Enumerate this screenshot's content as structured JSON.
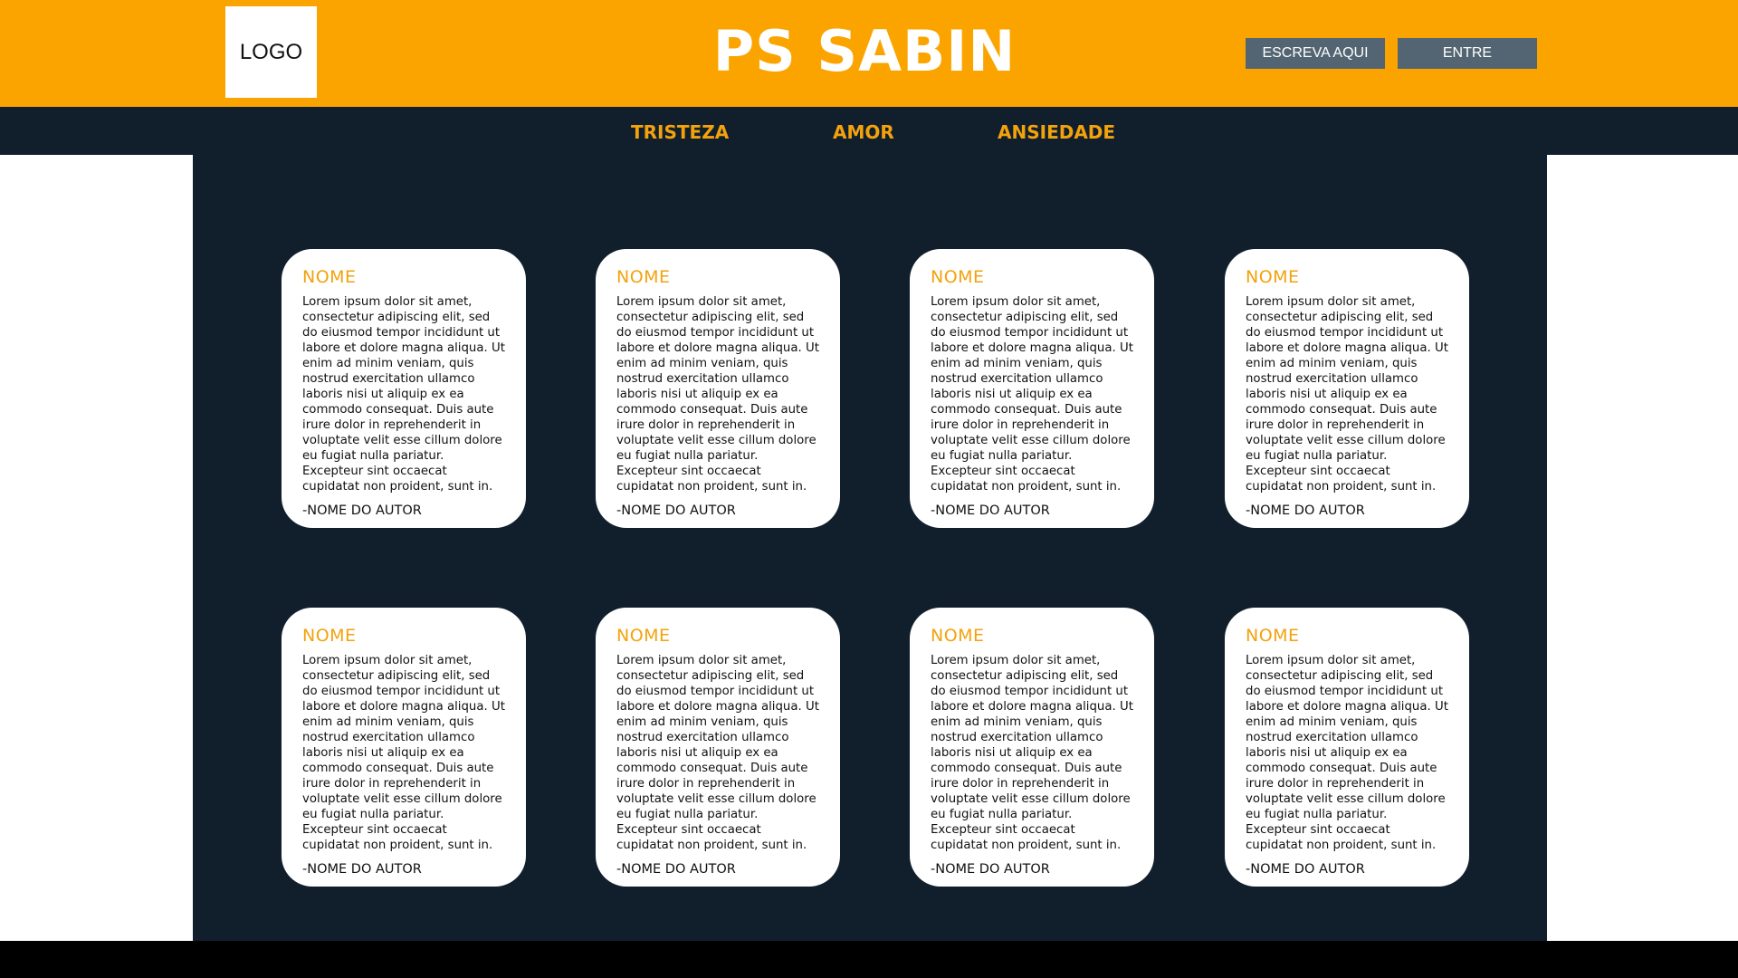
{
  "header": {
    "logo_label": "LOGO",
    "title": "PS SABIN",
    "write_button": "ESCREVA AQUI",
    "login_button": "ENTRE",
    "background_color": "#fba400"
  },
  "nav": {
    "items": [
      "TRISTEZA",
      "AMOR",
      "ANSIEDADE"
    ],
    "text_color": "#f3a20d",
    "background_color": "#111f2c"
  },
  "cards": [
    {
      "name": "NOME",
      "text": "Lorem ipsum dolor sit amet, consectetur adipiscing elit, sed do eiusmod tempor incididunt ut labore et dolore magna aliqua. Ut enim ad minim veniam, quis nostrud exercitation ullamco laboris nisi ut aliquip ex ea commodo consequat. Duis aute irure dolor in reprehenderit in voluptate velit esse cillum dolore eu fugiat nulla pariatur. Excepteur sint occaecat cupidatat non proident, sunt in.",
      "author": "-NOME DO AUTOR"
    },
    {
      "name": "NOME",
      "text": "Lorem ipsum dolor sit amet, consectetur adipiscing elit, sed do eiusmod tempor incididunt ut labore et dolore magna aliqua. Ut enim ad minim veniam, quis nostrud exercitation ullamco laboris nisi ut aliquip ex ea commodo consequat. Duis aute irure dolor in reprehenderit in voluptate velit esse cillum dolore eu fugiat nulla pariatur. Excepteur sint occaecat cupidatat non proident, sunt in.",
      "author": "-NOME DO AUTOR"
    },
    {
      "name": "NOME",
      "text": "Lorem ipsum dolor sit amet, consectetur adipiscing elit, sed do eiusmod tempor incididunt ut labore et dolore magna aliqua. Ut enim ad minim veniam, quis nostrud exercitation ullamco laboris nisi ut aliquip ex ea commodo consequat. Duis aute irure dolor in reprehenderit in voluptate velit esse cillum dolore eu fugiat nulla pariatur. Excepteur sint occaecat cupidatat non proident, sunt in.",
      "author": "-NOME DO AUTOR"
    },
    {
      "name": "NOME",
      "text": "Lorem ipsum dolor sit amet, consectetur adipiscing elit, sed do eiusmod tempor incididunt ut labore et dolore magna aliqua. Ut enim ad minim veniam, quis nostrud exercitation ullamco laboris nisi ut aliquip ex ea commodo consequat. Duis aute irure dolor in reprehenderit in voluptate velit esse cillum dolore eu fugiat nulla pariatur. Excepteur sint occaecat cupidatat non proident, sunt in.",
      "author": "-NOME DO AUTOR"
    },
    {
      "name": "NOME",
      "text": "Lorem ipsum dolor sit amet, consectetur adipiscing elit, sed do eiusmod tempor incididunt ut labore et dolore magna aliqua. Ut enim ad minim veniam, quis nostrud exercitation ullamco laboris nisi ut aliquip ex ea commodo consequat. Duis aute irure dolor in reprehenderit in voluptate velit esse cillum dolore eu fugiat nulla pariatur. Excepteur sint occaecat cupidatat non proident, sunt in.",
      "author": "-NOME DO AUTOR"
    },
    {
      "name": "NOME",
      "text": "Lorem ipsum dolor sit amet, consectetur adipiscing elit, sed do eiusmod tempor incididunt ut labore et dolore magna aliqua. Ut enim ad minim veniam, quis nostrud exercitation ullamco laboris nisi ut aliquip ex ea commodo consequat. Duis aute irure dolor in reprehenderit in voluptate velit esse cillum dolore eu fugiat nulla pariatur. Excepteur sint occaecat cupidatat non proident, sunt in.",
      "author": "-NOME DO AUTOR"
    },
    {
      "name": "NOME",
      "text": "Lorem ipsum dolor sit amet, consectetur adipiscing elit, sed do eiusmod tempor incididunt ut labore et dolore magna aliqua. Ut enim ad minim veniam, quis nostrud exercitation ullamco laboris nisi ut aliquip ex ea commodo consequat. Duis aute irure dolor in reprehenderit in voluptate velit esse cillum dolore eu fugiat nulla pariatur. Excepteur sint occaecat cupidatat non proident, sunt in.",
      "author": "-NOME DO AUTOR"
    },
    {
      "name": "NOME",
      "text": "Lorem ipsum dolor sit amet, consectetur adipiscing elit, sed do eiusmod tempor incididunt ut labore et dolore magna aliqua. Ut enim ad minim veniam, quis nostrud exercitation ullamco laboris nisi ut aliquip ex ea commodo consequat. Duis aute irure dolor in reprehenderit in voluptate velit esse cillum dolore eu fugiat nulla pariatur. Excepteur sint occaecat cupidatat non proident, sunt in.",
      "author": "-NOME DO AUTOR"
    }
  ]
}
